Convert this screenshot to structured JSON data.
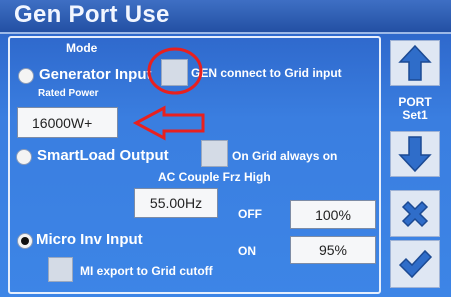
{
  "header": {
    "title": "Gen Port Use"
  },
  "mode": {
    "label": "Mode",
    "generator_input": {
      "label": "Generator Input",
      "selected": false
    },
    "gen_connect": {
      "label": "GEN connect to Grid input",
      "checked": false
    },
    "rated_power": {
      "label": "Rated Power",
      "value": "16000W+"
    },
    "smartload_output": {
      "label": "SmartLoad Output",
      "selected": false
    },
    "on_grid_always_on": {
      "label": "On Grid always on",
      "checked": false
    },
    "ac_couple": {
      "label": "AC Couple Frz High",
      "value": "55.00Hz"
    },
    "off": {
      "label": "OFF",
      "value": "100%"
    },
    "micro_inv_input": {
      "label": "Micro Inv Input",
      "selected": true
    },
    "on": {
      "label": "ON",
      "value": "95%"
    },
    "mi_export": {
      "label": "MI export to Grid cutoff",
      "checked": false
    }
  },
  "side": {
    "port_label_1": "PORT",
    "port_label_2": "Set1",
    "up_icon": "up-arrow-icon",
    "down_icon": "down-arrow-icon",
    "cancel_icon": "x-icon",
    "confirm_icon": "check-icon"
  },
  "colors": {
    "background": "#3a7ee0",
    "title_bar": "#2350a4",
    "annotation": "#e8201f"
  }
}
